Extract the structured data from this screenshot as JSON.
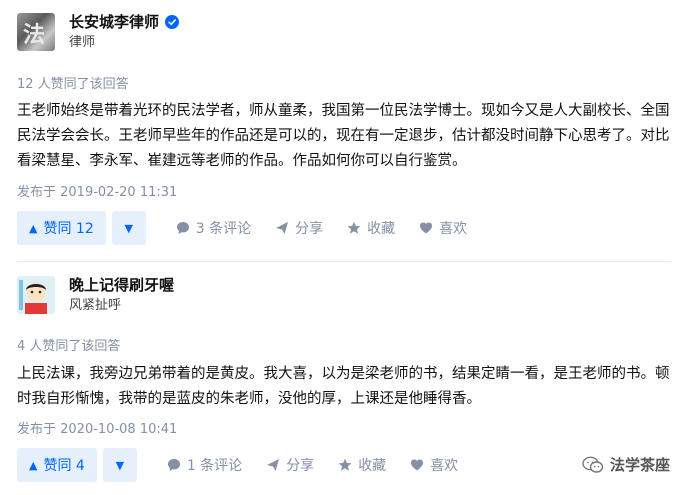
{
  "answers": [
    {
      "author": {
        "name": "长安城李律师",
        "headline": "律师",
        "avatar_icon": "avatar-image-law",
        "verified_icon": "verified-badge-icon"
      },
      "votes_text": "12 人赞同了该回答",
      "content": "王老师始终是带着光环的民法学者，师从童柔，我国第一位民法学博士。现如今又是人大副校长、全国民法学会会长。王老师早些年的作品还是可以的，现在有一定退步，估计都没时间静下心思考了。对比看梁慧星、李永军、崔建远等老师的作品。作品如何你可以自行鉴赏。",
      "time": "发布于 2019-02-20 11:31",
      "vote_label": "赞同 12",
      "comment_label": "3 条评论",
      "share_label": "分享",
      "collect_label": "收藏",
      "like_label": "喜欢"
    },
    {
      "author": {
        "name": "晚上记得刷牙喔",
        "headline": "风紧扯呼",
        "avatar_icon": "avatar-image-cartoon"
      },
      "votes_text": "4 人赞同了该回答",
      "content": "上民法课，我旁边兄弟带着的是黄皮。我大喜，以为是梁老师的书，结果定睛一看，是王老师的书。顿时我自形惭愧，我带的是蓝皮的朱老师，没他的厚，上课还是他睡得香。",
      "time": "发布于 2020-10-08 10:41",
      "vote_label": "赞同 4",
      "comment_label": "1 条评论",
      "share_label": "分享",
      "collect_label": "收藏",
      "like_label": "喜欢"
    }
  ],
  "watermark": {
    "text": "法学茶座",
    "icon": "wechat-icon"
  },
  "colors": {
    "accent": "#0066ff",
    "accent_bg": "#e6f0fd",
    "meta": "#8590a6",
    "divider": "#ebebeb"
  }
}
